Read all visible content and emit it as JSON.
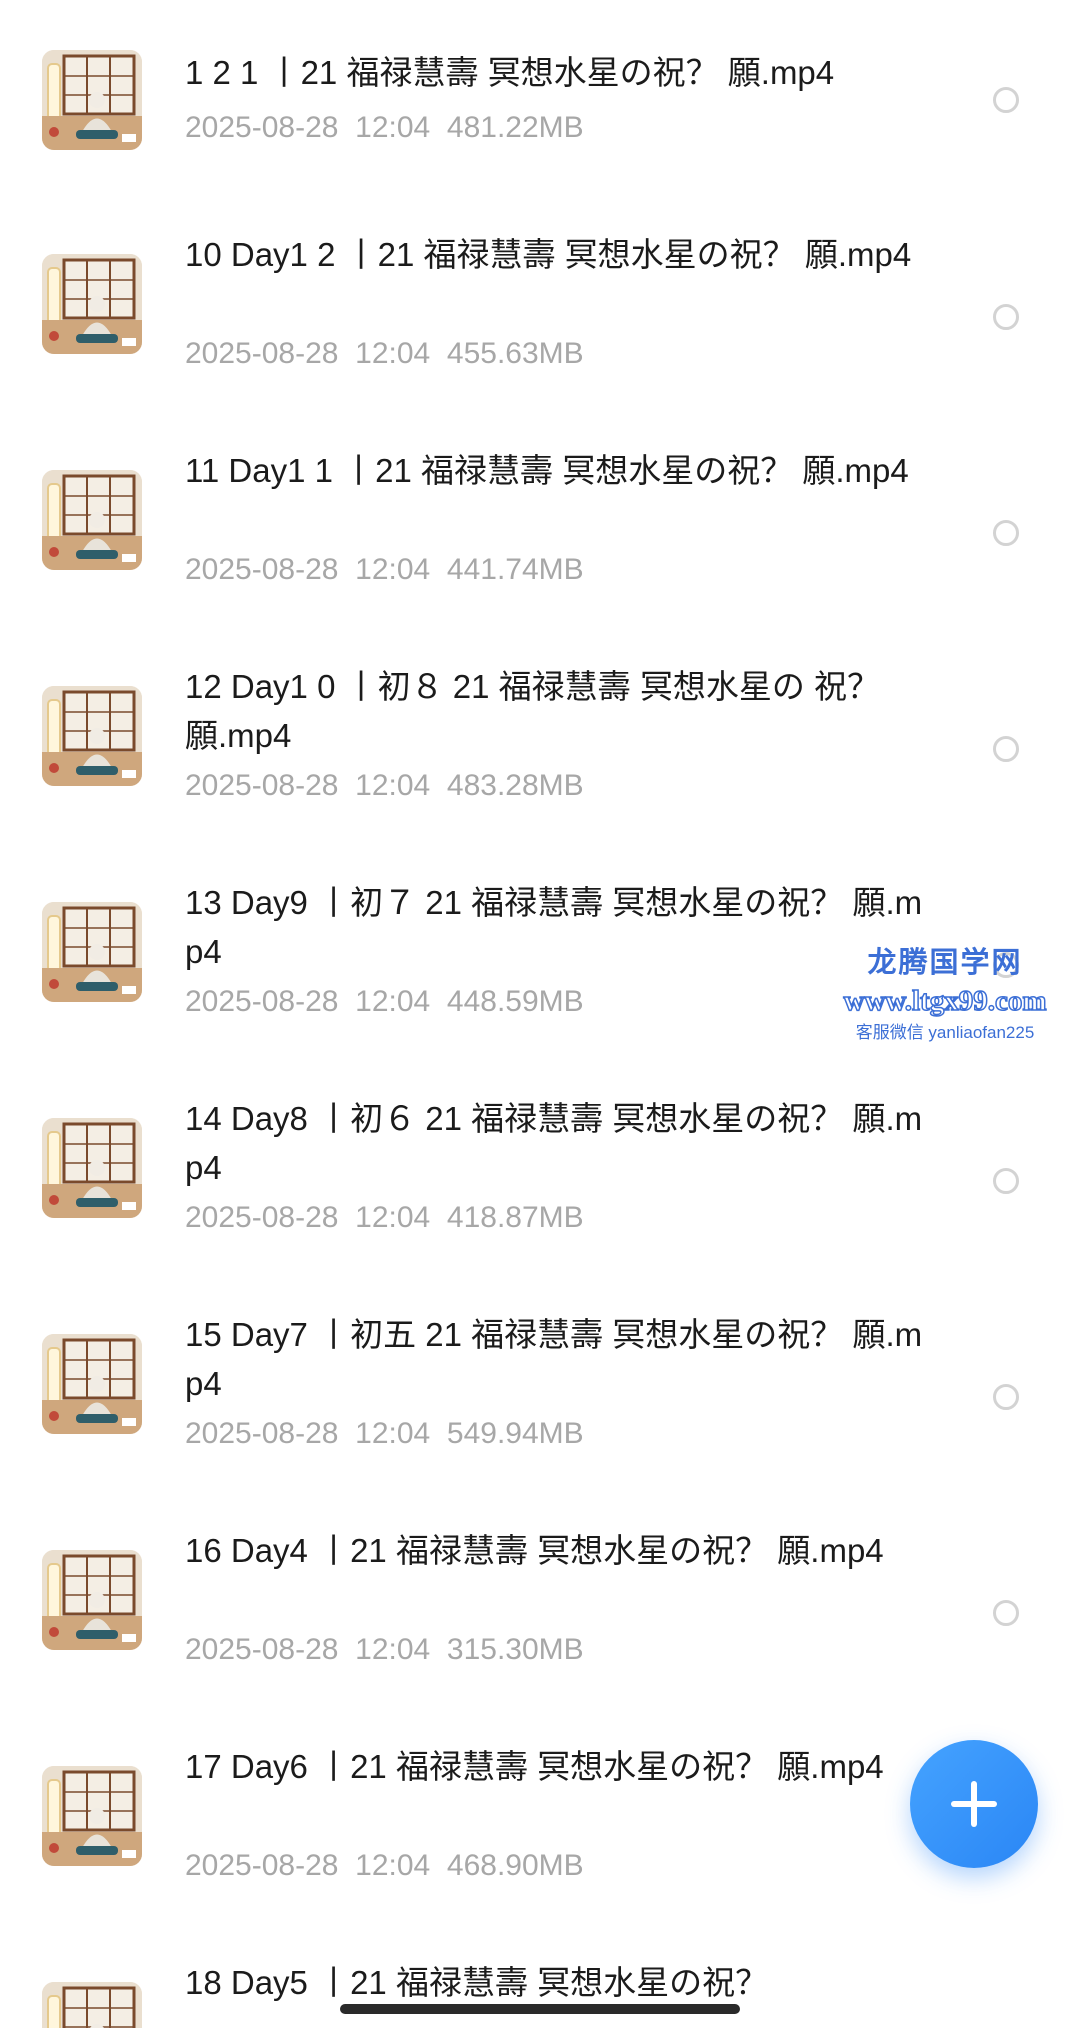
{
  "files": [
    {
      "name": "1 2 1 丨21 福禄慧壽 冥想水星の祝？ 願.mp4",
      "date": "2025-08-28",
      "time": "12:04",
      "size": "481.22MB"
    },
    {
      "name": "10 Day1 2 丨21 福禄慧壽 冥想水星の祝？ 願.mp4",
      "date": "2025-08-28",
      "time": "12:04",
      "size": "455.63MB"
    },
    {
      "name": "11 Day1 1 丨21 福禄慧壽 冥想水星の祝？ 願.mp4",
      "date": "2025-08-28",
      "time": "12:04",
      "size": "441.74MB"
    },
    {
      "name": "12 Day1 0 丨初８ 21 福禄慧壽 冥想水星の 祝？ 願.mp4",
      "date": "2025-08-28",
      "time": "12:04",
      "size": "483.28MB"
    },
    {
      "name": "13 Day9 丨初７ 21 福禄慧壽 冥想水星の祝？ 願.mp4",
      "date": "2025-08-28",
      "time": "12:04",
      "size": "448.59MB"
    },
    {
      "name": "14 Day8 丨初６ 21 福禄慧壽 冥想水星の祝？ 願.mp4",
      "date": "2025-08-28",
      "time": "12:04",
      "size": "418.87MB"
    },
    {
      "name": "15 Day7 丨初五 21 福禄慧壽 冥想水星の祝？ 願.mp4",
      "date": "2025-08-28",
      "time": "12:04",
      "size": "549.94MB"
    },
    {
      "name": "16 Day4 丨21 福禄慧壽 冥想水星の祝？ 願.mp4",
      "date": "2025-08-28",
      "time": "12:04",
      "size": "315.30MB"
    },
    {
      "name": "17 Day6 丨21 福禄慧壽 冥想水星の祝？ 願.mp4",
      "date": "2025-08-28",
      "time": "12:04",
      "size": "468.90MB"
    },
    {
      "name": "18 Day5 丨21 福禄慧壽 冥想水星の祝？",
      "date": "",
      "time": "",
      "size": ""
    }
  ],
  "watermark": {
    "title": "龙腾国学网",
    "url": "www.ltgx99.com",
    "contact": "客服微信 yanliaofan225"
  },
  "fab": {
    "icon": "plus-icon"
  },
  "colors": {
    "accent": "#2a86f5",
    "text": "#1b1b1b",
    "meta": "#a7a7a7",
    "watermark": "#3c6fd6"
  }
}
